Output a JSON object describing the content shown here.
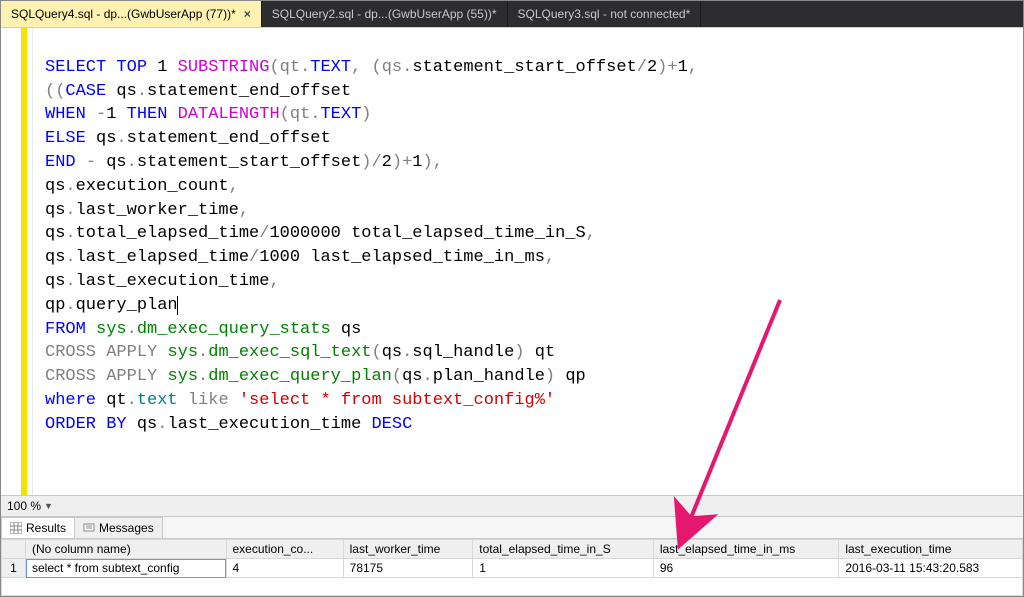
{
  "tabs": [
    {
      "label": "SQLQuery4.sql - dp...(GwbUserApp (77))*",
      "active": true
    },
    {
      "label": "SQLQuery2.sql - dp...(GwbUserApp (55))*",
      "active": false
    },
    {
      "label": "SQLQuery3.sql - not connected*",
      "active": false
    }
  ],
  "zoom": "100 %",
  "result_tabs": {
    "results": "Results",
    "messages": "Messages"
  },
  "grid": {
    "columns": [
      "(No column name)",
      "execution_co...",
      "last_worker_time",
      "total_elapsed_time_in_S",
      "last_elapsed_time_in_ms",
      "last_execution_time"
    ],
    "rownum": "1",
    "cells": [
      "select * from subtext_config",
      "4",
      "78175",
      "1",
      "96",
      "2016-03-11 15:43:20.583"
    ]
  },
  "sql": {
    "l1": {
      "a": "SELECT",
      "b": "TOP",
      "c": "1",
      "d": "SUBSTRING",
      "e": "(qt",
      "f": ".",
      "g": "TEXT",
      "h": ", (qs",
      "i": ".",
      "j": "statement_start_offset",
      "k": "/",
      "l": "2",
      "m": ")",
      "n": "+",
      "o": "1",
      "p": ","
    },
    "l2": {
      "a": "((",
      "b": "CASE",
      "c": " qs",
      "d": ".",
      "e": "statement_end_offset"
    },
    "l3": {
      "a": "WHEN",
      "b": "-",
      "c": "1",
      "d": "THEN",
      "e": "DATALENGTH",
      "f": "(qt",
      "g": ".",
      "h": "TEXT",
      "i": ")"
    },
    "l4": {
      "a": "ELSE",
      "b": " qs",
      "c": ".",
      "d": "statement_end_offset"
    },
    "l5": {
      "a": "END",
      "b": "-",
      "c": " qs",
      "d": ".",
      "e": "statement_start_offset",
      "f": ")",
      "g": "/",
      "h": "2",
      "i": ")",
      "j": "+",
      "k": "1",
      "l": ")",
      "m": ","
    },
    "l6": {
      "a": "qs",
      "b": ".",
      "c": "execution_count",
      "d": ","
    },
    "l7": {
      "a": "qs",
      "b": ".",
      "c": "last_worker_time",
      "d": ","
    },
    "l8": {
      "a": "qs",
      "b": ".",
      "c": "total_elapsed_time",
      "d": "/",
      "e": "1000000",
      "f": " total_elapsed_time_in_S",
      "g": ","
    },
    "l9": {
      "a": "qs",
      "b": ".",
      "c": "last_elapsed_time",
      "d": "/",
      "e": "1000",
      "f": " last_elapsed_time_in_ms",
      "g": ","
    },
    "l10": {
      "a": "qs",
      "b": ".",
      "c": "last_execution_time",
      "d": ","
    },
    "l11": {
      "a": "qp",
      "b": ".",
      "c": "query_plan"
    },
    "l12": {
      "a": "FROM",
      "b": "sys",
      "c": ".",
      "d": "dm_exec_query_stats",
      "e": " qs"
    },
    "l13": {
      "a": "CROSS",
      "b": "APPLY",
      "c": "sys",
      "d": ".",
      "e": "dm_exec_sql_text",
      "f": "(",
      "g": "qs",
      "h": ".",
      "i": "sql_handle",
      "j": ")",
      "k": " qt"
    },
    "l14": {
      "a": "CROSS",
      "b": "APPLY",
      "c": "sys",
      "d": ".",
      "e": "dm_exec_query_plan",
      "f": "(",
      "g": "qs",
      "h": ".",
      "i": "plan_handle",
      "j": ")",
      "k": " qp"
    },
    "l15": {
      "a": "where",
      "b": " qt",
      "c": ".",
      "d": "text",
      "e": "like",
      "f": "'select * from subtext_config%'"
    },
    "l16": {
      "a": "ORDER",
      "b": "BY",
      "c": " qs",
      "d": ".",
      "e": "last_execution_time",
      "f": "DESC"
    }
  }
}
